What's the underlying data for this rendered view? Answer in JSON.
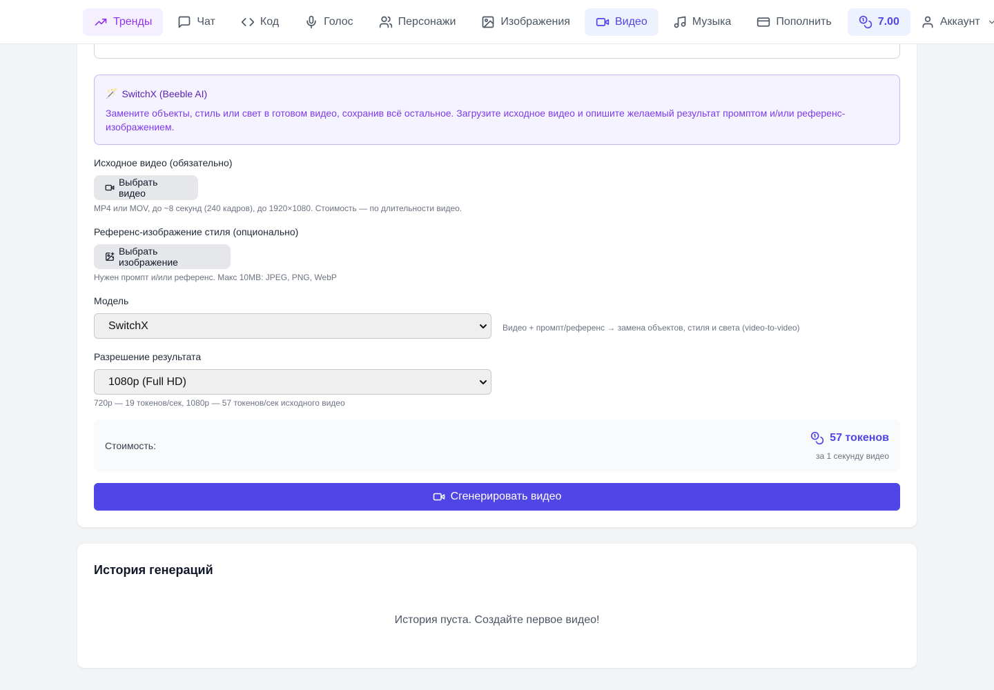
{
  "nav": {
    "items": [
      {
        "label": "Тренды",
        "icon": "trending-up-icon"
      },
      {
        "label": "Чат",
        "icon": "chat-bubble-icon"
      },
      {
        "label": "Код",
        "icon": "code-icon"
      },
      {
        "label": "Голос",
        "icon": "microphone-icon"
      },
      {
        "label": "Персонажи",
        "icon": "users-icon"
      },
      {
        "label": "Изображения",
        "icon": "image-icon"
      },
      {
        "label": "Видео",
        "icon": "video-camera-icon"
      },
      {
        "label": "Музыка",
        "icon": "music-note-icon"
      },
      {
        "label": "Пополнить",
        "icon": "credit-card-icon"
      }
    ],
    "balance": "7.00",
    "account_label": "Аккаунт",
    "active": "Видео"
  },
  "info": {
    "title": "SwitchX (Beeble AI)",
    "text": "Замените объекты, стиль или свет в готовом видео, сохранив всё остальное. Загрузите исходное видео и опишите желаемый результат промптом и/или референс-изображением."
  },
  "source_video": {
    "label": "Исходное видео (обязательно)",
    "button": "Выбрать видео",
    "hint": "MP4 или MOV, до ~8 секунд (240 кадров), до 1920×1080. Стоимость — по длительности видео."
  },
  "reference_image": {
    "label": "Референс-изображение стиля (опционально)",
    "button": "Выбрать изображение",
    "hint": "Нужен промпт и/или референс. Макс 10MB: JPEG, PNG, WebP"
  },
  "model": {
    "label": "Модель",
    "selected": "SwitchX",
    "description": "Видео + промпт/референс → замена объектов, стиля и света (video-to-video)"
  },
  "resolution": {
    "label": "Разрешение результата",
    "selected": "1080p (Full HD)",
    "hint": "720p — 19 токенов/сек, 1080p — 57 токенов/сек исходного видео"
  },
  "cost": {
    "label": "Стоимость:",
    "value": "57 токенов",
    "sub": "за 1 секунду видео"
  },
  "generate_button": "Сгенерировать видео",
  "history": {
    "title": "История генераций",
    "empty": "История пуста. Создайте первое видео!"
  },
  "colors": {
    "accent": "#4f46e5",
    "trend": "#9333ea",
    "info_bg": "#f5f3ff",
    "info_border": "#c4b5fd"
  }
}
